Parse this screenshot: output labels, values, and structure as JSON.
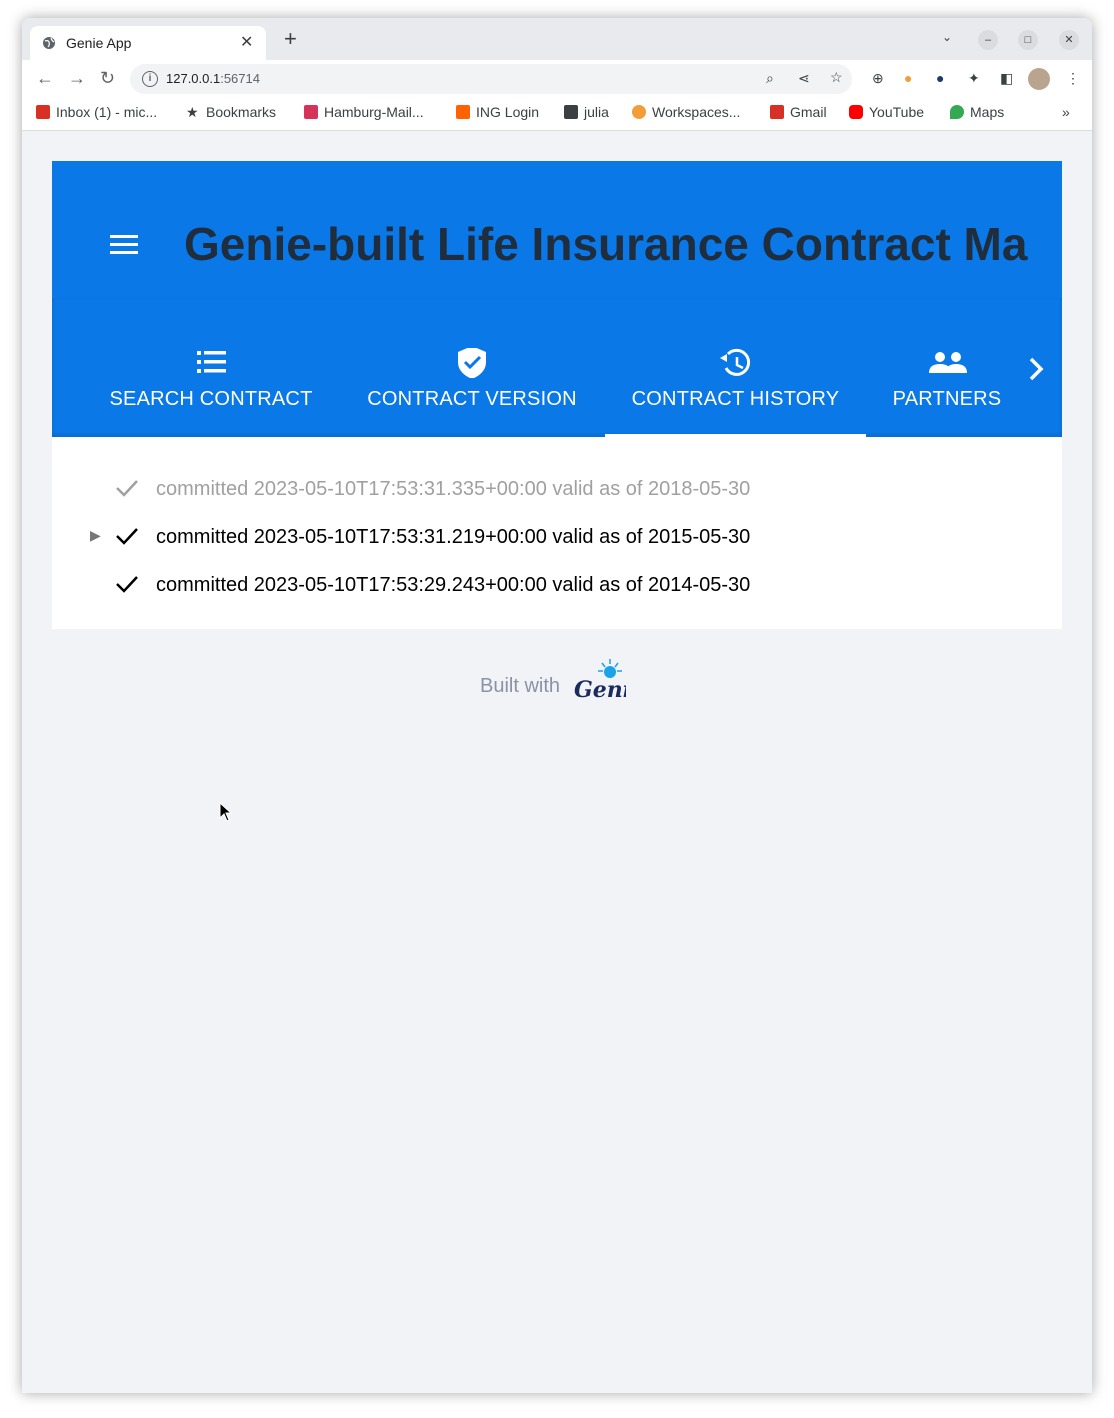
{
  "browser": {
    "tab_title": "Genie App",
    "tab_close": "✕",
    "new_tab": "+",
    "url_host": "127.0.0.1",
    "url_port": ":56714",
    "bookmarks": [
      {
        "label": "Inbox (1) - mic...",
        "color": "#d93025"
      },
      {
        "label": "Bookmarks",
        "color": "#3c4043"
      },
      {
        "label": "Hamburg-Mail...",
        "color": "#d6335a"
      },
      {
        "label": "ING Login",
        "color": "#ff6200"
      },
      {
        "label": "julia",
        "color": "#3c4043"
      },
      {
        "label": "Workspaces...",
        "color": "#f29d38"
      },
      {
        "label": "Gmail",
        "color": "#d93025"
      },
      {
        "label": "YouTube",
        "color": "#ff0000"
      },
      {
        "label": "Maps",
        "color": "#34a853"
      }
    ],
    "bookmarks_more": "»"
  },
  "app": {
    "title": "Genie-built Life Insurance Contract Ma",
    "header_color": "#0a78e6",
    "tabs": [
      {
        "label": "SEARCH CONTRACT",
        "icon": "list-icon",
        "active": false
      },
      {
        "label": "CONTRACT VERSION",
        "icon": "verified-shield-icon",
        "active": false
      },
      {
        "label": "CONTRACT HISTORY",
        "icon": "history-icon",
        "active": true
      },
      {
        "label": "PARTNERS",
        "icon": "people-icon",
        "active": false
      }
    ]
  },
  "history": [
    {
      "text": "committed 2023-05-10T17:53:31.335+00:00 valid as of 2018-05-30",
      "dimmed": true,
      "expandable": false
    },
    {
      "text": "committed 2023-05-10T17:53:31.219+00:00 valid as of 2015-05-30",
      "dimmed": false,
      "expandable": true
    },
    {
      "text": "committed 2023-05-10T17:53:29.243+00:00 valid as of 2014-05-30",
      "dimmed": false,
      "expandable": false
    }
  ],
  "footer": {
    "built_with": "Built with",
    "logo_text": "Genie"
  }
}
